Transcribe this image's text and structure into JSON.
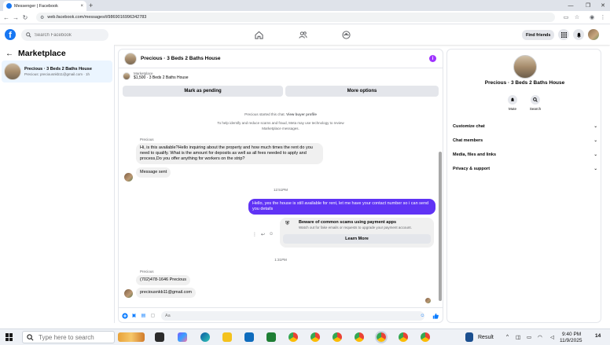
{
  "browser": {
    "tab_title": "Messenger | Facebook",
    "tab_close": "×",
    "new_tab": "+",
    "url": "web.facebook.com/messages/t/9869016996342783"
  },
  "header": {
    "search_placeholder": "Search Facebook",
    "find_friends": "Find friends"
  },
  "sidebar": {
    "title": "Marketplace",
    "conversation": {
      "name": "Precious · 3 Beds 2 Baths House",
      "preview": "Precious: preciousnkb11@gmail.com · 1h"
    }
  },
  "chat": {
    "title": "Precious · 3 Beds 2 Baths House",
    "listing_source": "Marketplace",
    "listing_line": "$1,500 · 3 Beds 2 Baths House",
    "mark_pending": "Mark as pending",
    "more_options": "More options",
    "started_text": "Precious started this chat.",
    "view_buyer_profile": "View buyer profile",
    "privacy_line1": "To help identify and reduce scams and fraud, Meta may use technology to review",
    "privacy_line2": "Marketplace messages.",
    "sender_name": "Precious",
    "msg1": "Hi, is this available?Hello inquiring about the property and how much times the rent do you need to qualify. What is the amount for deposits as well as all fees needed to apply and process,Do you offer anything for workers on the strip?",
    "msg2": "Message sent",
    "time1": "12:51PM",
    "reply": "Hello, yes the house is still available for rent, let me have your contact number so i can send you  details",
    "scam_title": "Beware of common scams using payment apps",
    "scam_sub": "Watch out for fake emails or requests to upgrade your payment account.",
    "learn_more": "Learn More",
    "time2": "1:31PM",
    "sender_name2": "Precious",
    "msg3": "(702)478-1646 Precious",
    "msg4": "preciousnkb11@gmail.com",
    "composer_placeholder": "Aa"
  },
  "right_panel": {
    "name": "Precious · 3 Beds 2 Baths House",
    "mute": "Mute",
    "search": "Search",
    "sections": [
      "Customize chat",
      "Chat members",
      "Media, files and links",
      "Privacy & support"
    ]
  },
  "taskbar": {
    "search_placeholder": "Type here to search",
    "widget": "Result",
    "time": "9:40 PM",
    "date": "11/9/2025",
    "badge": "14"
  },
  "colors": {
    "fb_blue": "#1877f2",
    "outgoing_bubble": "#6033f5",
    "selected_convo": "#ebf5ff"
  }
}
